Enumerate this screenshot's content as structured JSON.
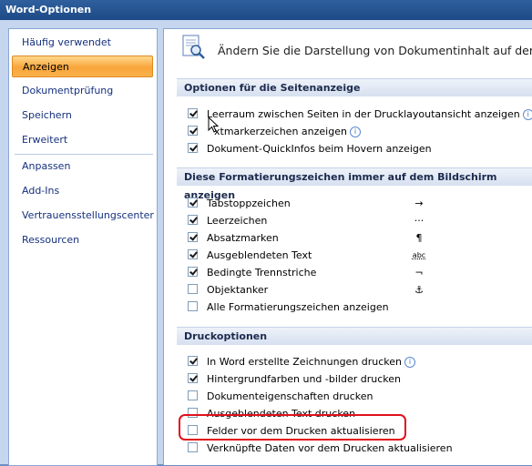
{
  "window": {
    "title": "Word-Optionen"
  },
  "sidebar": {
    "items": [
      {
        "label": "Häufig verwendet",
        "active": false
      },
      {
        "label": "Anzeigen",
        "active": true
      },
      {
        "label": "Dokumentprüfung",
        "active": false
      },
      {
        "label": "Speichern",
        "active": false
      },
      {
        "label": "Erweitert",
        "active": false
      },
      {
        "label": "Anpassen",
        "active": false
      },
      {
        "label": "Add-Ins",
        "active": false
      },
      {
        "label": "Vertrauensstellungscenter",
        "active": false
      },
      {
        "label": "Ressourcen",
        "active": false
      }
    ]
  },
  "header": {
    "text": "Ändern Sie die Darstellung von Dokumentinhalt auf dem Bil"
  },
  "sections": [
    {
      "title": "Optionen für die Seitenanzeige",
      "options": [
        {
          "label": "Leerraum zwischen Seiten in der Drucklayoutansicht anzeigen",
          "checked": true,
          "info": true
        },
        {
          "label": "xtmarkerzeichen anzeigen",
          "checked": true,
          "info": true
        },
        {
          "label": "Dokument-QuickInfos beim Hovern anzeigen",
          "checked": true,
          "info": false
        }
      ]
    },
    {
      "title": "Diese Formatierungszeichen immer auf dem Bildschirm anzeigen",
      "options": [
        {
          "label": "Tabstoppzeichen",
          "checked": true,
          "symbol": "→"
        },
        {
          "label": "Leerzeichen",
          "checked": true,
          "symbol": "···"
        },
        {
          "label": "Absatzmarken",
          "checked": true,
          "symbol": "¶"
        },
        {
          "label": "Ausgeblendeten Text",
          "checked": true,
          "symbol": "abc"
        },
        {
          "label": "Bedingte Trennstriche",
          "checked": true,
          "symbol": "¬"
        },
        {
          "label": "Objektanker",
          "checked": false,
          "symbol": "⚓"
        },
        {
          "label": "Alle Formatierungszeichen anzeigen",
          "checked": false
        }
      ]
    },
    {
      "title": "Druckoptionen",
      "options": [
        {
          "label": "In Word erstellte Zeichnungen drucken",
          "checked": true,
          "info": true
        },
        {
          "label": "Hintergrundfarben und -bilder drucken",
          "checked": true
        },
        {
          "label": "Dokumenteigenschaften drucken",
          "checked": false
        },
        {
          "label": "Ausgeblendeten Text drucken",
          "checked": false
        },
        {
          "label": "Felder vor dem Drucken aktualisieren",
          "checked": false
        },
        {
          "label": "Verknüpfte Daten vor dem Drucken aktualisieren",
          "checked": false
        }
      ]
    }
  ]
}
